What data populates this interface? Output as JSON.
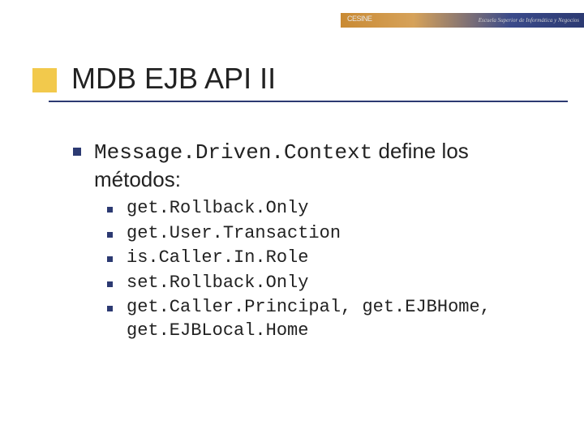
{
  "banner": {
    "logo": "CESINE",
    "tagline": "Escuela Superior de Informática y Negocios"
  },
  "title": "MDB EJB API II",
  "main": {
    "code": "Message.Driven.Context",
    "rest": " define los métodos:"
  },
  "items": [
    "get.Rollback.Only",
    "get.User.Transaction",
    "is.Caller.In.Role",
    "set.Rollback.Only",
    "get.Caller.Principal, get.EJBHome, get.EJBLocal.Home"
  ]
}
